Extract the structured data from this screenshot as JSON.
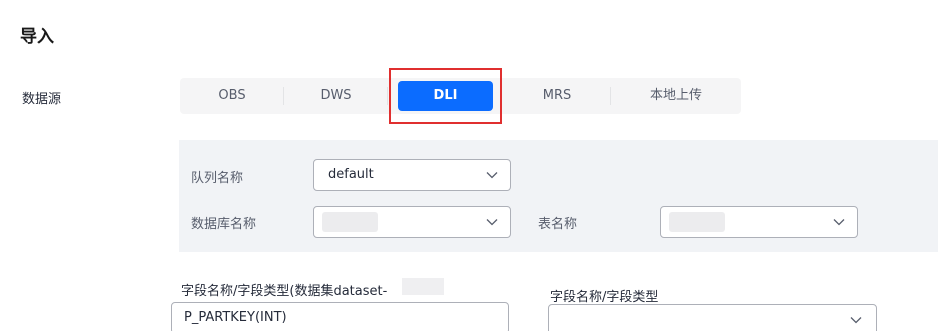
{
  "page": {
    "title": "导入"
  },
  "source": {
    "label": "数据源",
    "tabs": [
      "OBS",
      "DWS",
      "DLI",
      "MRS",
      "本地上传"
    ],
    "active": "DLI"
  },
  "panel": {
    "queue": {
      "label": "队列名称",
      "value": "default"
    },
    "database": {
      "label": "数据库名称",
      "value": ""
    },
    "table": {
      "label": "表名称",
      "value": ""
    }
  },
  "fields": {
    "left": {
      "label": "字段名称/字段类型(数据集dataset-",
      "value": "P_PARTKEY(INT)"
    },
    "right": {
      "label": "字段名称/字段类型",
      "value": ""
    }
  },
  "icons": {
    "dropdown": "chevron-down-icon"
  },
  "colors": {
    "accent": "#0b6cff",
    "highlight": "#e02f2f",
    "panel": "#f1f3f6"
  }
}
